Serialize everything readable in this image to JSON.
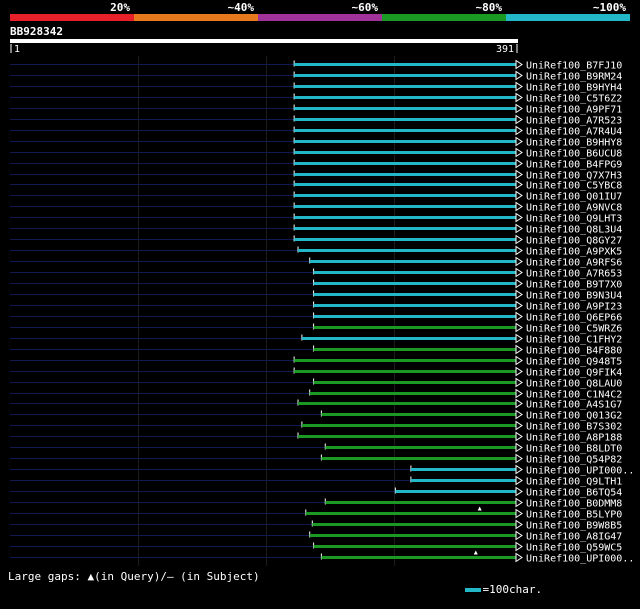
{
  "chart_data": {
    "type": "bar",
    "query_id": "BB928342",
    "query_length": 391,
    "axis_start": "1",
    "axis_end": "391",
    "legend": {
      "labels": [
        "20%",
        "~40%",
        "~60%",
        "~80%",
        "~100%"
      ],
      "colors": [
        "#e8202a",
        "#e87a1e",
        "#a0329a",
        "#1a9a24",
        "#22b8c8"
      ]
    },
    "hits": [
      {
        "name": "UniRef100_B7FJ10",
        "start": 220,
        "end": 391,
        "identity": "~100%",
        "color": "#22b8c8"
      },
      {
        "name": "UniRef100_B9RM24",
        "start": 220,
        "end": 391,
        "identity": "~100%",
        "color": "#22b8c8"
      },
      {
        "name": "UniRef100_B9HYH4",
        "start": 220,
        "end": 391,
        "identity": "~100%",
        "color": "#22b8c8"
      },
      {
        "name": "UniRef100_C5T6Z2",
        "start": 220,
        "end": 391,
        "identity": "~100%",
        "color": "#22b8c8"
      },
      {
        "name": "UniRef100_A9PF71",
        "start": 220,
        "end": 391,
        "identity": "~100%",
        "color": "#22b8c8"
      },
      {
        "name": "UniRef100_A7R523",
        "start": 220,
        "end": 391,
        "identity": "~100%",
        "color": "#22b8c8"
      },
      {
        "name": "UniRef100_A7R4U4",
        "start": 220,
        "end": 391,
        "identity": "~100%",
        "color": "#22b8c8"
      },
      {
        "name": "UniRef100_B9HHY8",
        "start": 220,
        "end": 391,
        "identity": "~100%",
        "color": "#22b8c8"
      },
      {
        "name": "UniRef100_B6UCU8",
        "start": 220,
        "end": 391,
        "identity": "~100%",
        "color": "#22b8c8"
      },
      {
        "name": "UniRef100_B4FPG9",
        "start": 220,
        "end": 391,
        "identity": "~100%",
        "color": "#22b8c8"
      },
      {
        "name": "UniRef100_Q7X7H3",
        "start": 220,
        "end": 391,
        "identity": "~100%",
        "color": "#22b8c8"
      },
      {
        "name": "UniRef100_C5YBC8",
        "start": 220,
        "end": 391,
        "identity": "~100%",
        "color": "#22b8c8"
      },
      {
        "name": "UniRef100_Q01IU7",
        "start": 220,
        "end": 391,
        "identity": "~100%",
        "color": "#22b8c8"
      },
      {
        "name": "UniRef100_A9NVC8",
        "start": 220,
        "end": 391,
        "identity": "~100%",
        "color": "#22b8c8"
      },
      {
        "name": "UniRef100_Q9LHT3",
        "start": 220,
        "end": 391,
        "identity": "~100%",
        "color": "#22b8c8"
      },
      {
        "name": "UniRef100_Q8L3U4",
        "start": 220,
        "end": 391,
        "identity": "~100%",
        "color": "#22b8c8"
      },
      {
        "name": "UniRef100_Q8GY27",
        "start": 220,
        "end": 391,
        "identity": "~100%",
        "color": "#22b8c8"
      },
      {
        "name": "UniRef100_A9PXK5",
        "start": 223,
        "end": 391,
        "identity": "~100%",
        "color": "#22b8c8"
      },
      {
        "name": "UniRef100_A9RFS6",
        "start": 232,
        "end": 391,
        "identity": "~100%",
        "color": "#22b8c8"
      },
      {
        "name": "UniRef100_A7R653",
        "start": 235,
        "end": 391,
        "identity": "~100%",
        "color": "#22b8c8"
      },
      {
        "name": "UniRef100_B9T7X0",
        "start": 235,
        "end": 391,
        "identity": "~100%",
        "color": "#22b8c8"
      },
      {
        "name": "UniRef100_B9N3U4",
        "start": 235,
        "end": 391,
        "identity": "~100%",
        "color": "#22b8c8"
      },
      {
        "name": "UniRef100_A9PI23",
        "start": 235,
        "end": 391,
        "identity": "~100%",
        "color": "#22b8c8"
      },
      {
        "name": "UniRef100_Q6EP66",
        "start": 235,
        "end": 391,
        "identity": "~100%",
        "color": "#22b8c8"
      },
      {
        "name": "UniRef100_C5WRZ6",
        "start": 235,
        "end": 391,
        "identity": "~80%",
        "color": "#1a9a24"
      },
      {
        "name": "UniRef100_C1FHY2",
        "start": 226,
        "end": 391,
        "identity": "~100%",
        "color": "#22b8c8"
      },
      {
        "name": "UniRef100_B4F880",
        "start": 235,
        "end": 391,
        "identity": "~80%",
        "color": "#1a9a24"
      },
      {
        "name": "UniRef100_Q948T5",
        "start": 220,
        "end": 391,
        "identity": "~80%",
        "color": "#1a9a24"
      },
      {
        "name": "UniRef100_Q9FIK4",
        "start": 220,
        "end": 391,
        "identity": "~80%",
        "color": "#1a9a24"
      },
      {
        "name": "UniRef100_Q8LAU0",
        "start": 235,
        "end": 391,
        "identity": "~80%",
        "color": "#1a9a24"
      },
      {
        "name": "UniRef100_C1N4C2",
        "start": 232,
        "end": 391,
        "identity": "~80%",
        "color": "#1a9a24"
      },
      {
        "name": "UniRef100_A4S1G7",
        "start": 223,
        "end": 391,
        "identity": "~80%",
        "color": "#1a9a24"
      },
      {
        "name": "UniRef100_Q013G2",
        "start": 241,
        "end": 391,
        "identity": "~80%",
        "color": "#1a9a24"
      },
      {
        "name": "UniRef100_B7S302",
        "start": 226,
        "end": 391,
        "identity": "~80%",
        "color": "#1a9a24"
      },
      {
        "name": "UniRef100_A8P188",
        "start": 223,
        "end": 391,
        "identity": "~80%",
        "color": "#1a9a24"
      },
      {
        "name": "UniRef100_B8LDT0",
        "start": 244,
        "end": 391,
        "identity": "~80%",
        "color": "#1a9a24"
      },
      {
        "name": "UniRef100_Q54P82",
        "start": 241,
        "end": 391,
        "identity": "~80%",
        "color": "#1a9a24"
      },
      {
        "name": "UniRef100_UPI000..",
        "start": 310,
        "end": 391,
        "identity": "~100%",
        "color": "#22b8c8"
      },
      {
        "name": "UniRef100_Q9LTH1",
        "start": 310,
        "end": 391,
        "identity": "~100%",
        "color": "#22b8c8"
      },
      {
        "name": "UniRef100_B6TQ54",
        "start": 298,
        "end": 391,
        "identity": "~100%",
        "color": "#22b8c8"
      },
      {
        "name": "UniRef100_B0DMM8",
        "start": 244,
        "end": 391,
        "identity": "~80%",
        "color": "#1a9a24"
      },
      {
        "name": "UniRef100_B5LYP0",
        "start": 229,
        "end": 391,
        "identity": "~80%",
        "color": "#1a9a24",
        "gap_at": 363
      },
      {
        "name": "UniRef100_B9W8B5",
        "start": 234,
        "end": 391,
        "identity": "~80%",
        "color": "#1a9a24"
      },
      {
        "name": "UniRef100_A8IG47",
        "start": 232,
        "end": 391,
        "identity": "~80%",
        "color": "#1a9a24"
      },
      {
        "name": "UniRef100_Q59WC5",
        "start": 235,
        "end": 391,
        "identity": "~80%",
        "color": "#1a9a24"
      },
      {
        "name": "UniRef100_UPI000..",
        "start": 241,
        "end": 391,
        "identity": "~80%",
        "color": "#1a9a24",
        "gap_at": 360
      }
    ],
    "footer_left": "Large gaps: ▲(in Query)/– (in Subject)",
    "footer_right": "=100char."
  }
}
